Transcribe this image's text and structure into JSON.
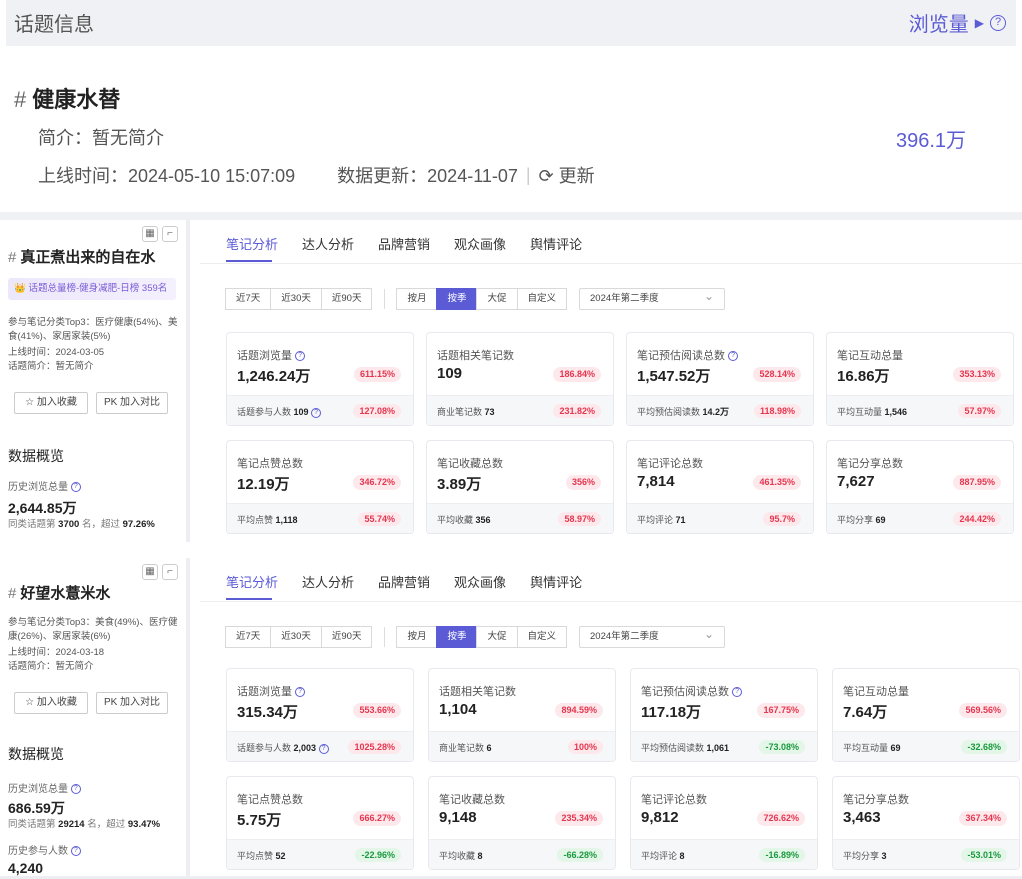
{
  "header": {
    "title": "话题信息",
    "metric": "浏览量",
    "help": "?"
  },
  "topic": {
    "hash": "#",
    "name": "健康水替",
    "intro": "简介：暂无简介",
    "views": "396.1万",
    "online_time": "上线时间：2024-05-10 15:07:09",
    "data_update": "数据更新：2024-11-07",
    "refresh": "⟳ 更新"
  },
  "panels": [
    {
      "title": "真正煮出来的自在水",
      "rank": "👑 话题总量榜-健身减肥-日榜 359名",
      "category": "参与笔记分类Top3：医疗健康(54%)、美食(41%)、家居家装(5%)",
      "online": "上线时间：2024-03-05",
      "intro": "话题简介：暂无简介",
      "fav_btn": "☆ 加入收藏",
      "pk_btn": "PK 加入对比",
      "overview": "数据概览",
      "hist_label": "历史浏览总量",
      "hist_val": "2,644.85万",
      "hist_rank_pre": "同类话题第",
      "hist_rank_num": "3700",
      "hist_rank_mid": "名，超过",
      "hist_rank_pct": "97.26%",
      "cards": [
        {
          "label": "话题浏览量",
          "help": true,
          "val": "1,246.24万",
          "badge": "611.15%",
          "dir": "up",
          "f_label": "话题参与人数",
          "f_val": "109",
          "f_help": true,
          "f_badge": "127.08%",
          "f_dir": "up"
        },
        {
          "label": "话题相关笔记数",
          "val": "109",
          "badge": "186.84%",
          "dir": "up",
          "f_label": "商业笔记数",
          "f_val": "73",
          "f_badge": "231.82%",
          "f_dir": "up"
        },
        {
          "label": "笔记预估阅读总数",
          "help": true,
          "val": "1,547.52万",
          "badge": "528.14%",
          "dir": "up",
          "f_label": "平均预估阅读数",
          "f_val": "14.2万",
          "f_badge": "118.98%",
          "f_dir": "up"
        },
        {
          "label": "笔记互动总量",
          "val": "16.86万",
          "badge": "353.13%",
          "dir": "up",
          "f_label": "平均互动量",
          "f_val": "1,546",
          "f_badge": "57.97%",
          "f_dir": "up"
        },
        {
          "label": "笔记点赞总数",
          "val": "12.19万",
          "badge": "346.72%",
          "dir": "up",
          "f_label": "平均点赞",
          "f_val": "1,118",
          "f_badge": "55.74%",
          "f_dir": "up"
        },
        {
          "label": "笔记收藏总数",
          "val": "3.89万",
          "badge": "356%",
          "dir": "up",
          "f_label": "平均收藏",
          "f_val": "356",
          "f_badge": "58.97%",
          "f_dir": "up"
        },
        {
          "label": "笔记评论总数",
          "val": "7,814",
          "badge": "461.35%",
          "dir": "up",
          "f_label": "平均评论",
          "f_val": "71",
          "f_badge": "95.7%",
          "f_dir": "up"
        },
        {
          "label": "笔记分享总数",
          "val": "7,627",
          "badge": "887.95%",
          "dir": "up",
          "f_label": "平均分享",
          "f_val": "69",
          "f_badge": "244.42%",
          "f_dir": "up"
        }
      ]
    },
    {
      "title": "好望水薏米水",
      "category": "参与笔记分类Top3：美食(49%)、医疗健康(26%)、家居家装(6%)",
      "online": "上线时间：2024-03-18",
      "intro": "话题简介：暂无简介",
      "fav_btn": "☆ 加入收藏",
      "pk_btn": "PK 加入对比",
      "overview": "数据概览",
      "hist_label": "历史浏览总量",
      "hist_val": "686.59万",
      "hist_rank_pre": "同类话题第",
      "hist_rank_num": "29214",
      "hist_rank_mid": "名，超过",
      "hist_rank_pct": "93.47%",
      "hist2_label": "历史参与人数",
      "hist2_val": "4,240",
      "cards": [
        {
          "label": "话题浏览量",
          "help": true,
          "val": "315.34万",
          "badge": "553.66%",
          "dir": "up",
          "f_label": "话题参与人数",
          "f_val": "2,003",
          "f_help": true,
          "f_badge": "1025.28%",
          "f_dir": "up"
        },
        {
          "label": "话题相关笔记数",
          "val": "1,104",
          "badge": "894.59%",
          "dir": "up",
          "f_label": "商业笔记数",
          "f_val": "6",
          "f_badge": "100%",
          "f_dir": "up"
        },
        {
          "label": "笔记预估阅读总数",
          "help": true,
          "val": "117.18万",
          "badge": "167.75%",
          "dir": "up",
          "f_label": "平均预估阅读数",
          "f_val": "1,061",
          "f_badge": "-73.08%",
          "f_dir": "down"
        },
        {
          "label": "笔记互动总量",
          "val": "7.64万",
          "badge": "569.56%",
          "dir": "up",
          "f_label": "平均互动量",
          "f_val": "69",
          "f_badge": "-32.68%",
          "f_dir": "down"
        },
        {
          "label": "笔记点赞总数",
          "val": "5.75万",
          "badge": "666.27%",
          "dir": "up",
          "f_label": "平均点赞",
          "f_val": "52",
          "f_badge": "-22.96%",
          "f_dir": "down"
        },
        {
          "label": "笔记收藏总数",
          "val": "9,148",
          "badge": "235.34%",
          "dir": "up",
          "f_label": "平均收藏",
          "f_val": "8",
          "f_badge": "-66.28%",
          "f_dir": "down"
        },
        {
          "label": "笔记评论总数",
          "val": "9,812",
          "badge": "726.62%",
          "dir": "up",
          "f_label": "平均评论",
          "f_val": "8",
          "f_badge": "-16.89%",
          "f_dir": "down"
        },
        {
          "label": "笔记分享总数",
          "val": "3,463",
          "badge": "367.34%",
          "dir": "up",
          "f_label": "平均分享",
          "f_val": "3",
          "f_badge": "-53.01%",
          "f_dir": "down"
        }
      ]
    }
  ],
  "tabs": [
    "笔记分析",
    "达人分析",
    "品牌营销",
    "观众画像",
    "舆情评论"
  ],
  "range_filters": [
    "近7天",
    "近30天",
    "近90天"
  ],
  "period_filters": [
    "按月",
    "按季",
    "大促",
    "自定义"
  ],
  "period_active": 1,
  "quarter_select": "2024年第二季度",
  "colors": {
    "accent": "#5b5bd6",
    "up": "#e5364f",
    "down": "#1a9a3e"
  }
}
